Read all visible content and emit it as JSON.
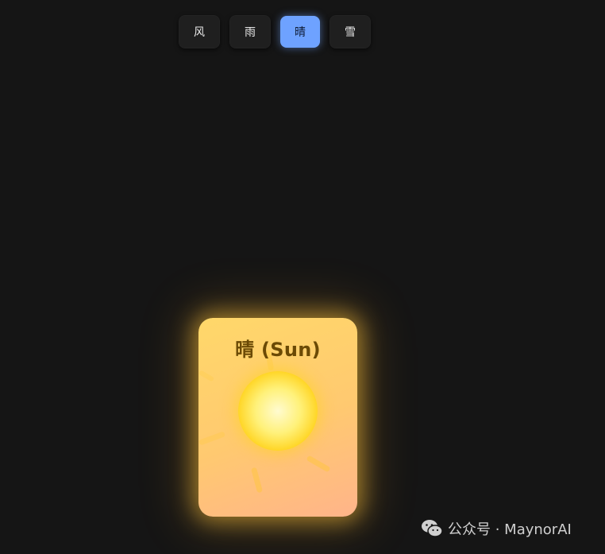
{
  "tabs": [
    {
      "label": "风",
      "active": false
    },
    {
      "label": "雨",
      "active": false
    },
    {
      "label": "晴",
      "active": true
    },
    {
      "label": "雪",
      "active": false
    }
  ],
  "card": {
    "title": "晴 (Sun)",
    "icon": "sun-icon"
  },
  "watermark": {
    "icon": "wechat-icon",
    "text": "公众号 · MaynorAI"
  },
  "colors": {
    "background": "#151515",
    "tab_bg": "#1f1f1f",
    "tab_active": "#6ea2ff",
    "card_top": "#ffd86a",
    "card_bottom": "#ffb48a",
    "sun": "#ffd21a",
    "title_text": "#6b4a05"
  }
}
